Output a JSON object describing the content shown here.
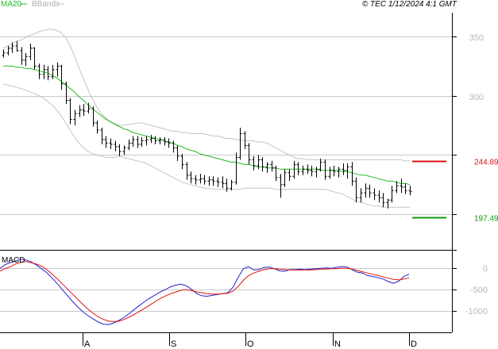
{
  "header": {
    "ma_label": "MA20",
    "bb_label": "BBands",
    "copyright": "© TEC 1/12/2024 4:1 GMT"
  },
  "colors": {
    "ma": "#22bb22",
    "bands": "#c4c4c4",
    "price": "#000000",
    "resistance": "#dd1111",
    "support": "#119911",
    "macd": "#2222cc",
    "signal": "#dd1111",
    "grid": "#c8c8c8",
    "tick": "#b8b8b8"
  },
  "chart_data": [
    {
      "type": "candlestick",
      "name": "price",
      "ylim": [
        170,
        370
      ],
      "yticks": [
        200,
        250,
        300,
        350
      ],
      "ytick_labels": [
        "",
        "",
        "300",
        "350"
      ],
      "x_months": [
        "A",
        "S",
        "O",
        "N",
        "D"
      ],
      "levels": [
        {
          "label": "244.89",
          "value": 244.89,
          "color": "#dd1111"
        },
        {
          "label": "197.49",
          "value": 197.49,
          "color": "#119911"
        }
      ],
      "bars": [
        [
          334,
          339,
          332,
          336
        ],
        [
          336,
          342,
          334,
          340
        ],
        [
          340,
          345,
          336,
          342
        ],
        [
          342,
          346,
          337,
          338
        ],
        [
          338,
          341,
          326,
          330
        ],
        [
          330,
          336,
          325,
          333
        ],
        [
          333,
          344,
          330,
          340
        ],
        [
          340,
          341,
          322,
          325
        ],
        [
          325,
          327,
          314,
          318
        ],
        [
          318,
          326,
          314,
          322
        ],
        [
          322,
          325,
          313,
          316
        ],
        [
          316,
          326,
          314,
          322
        ],
        [
          322,
          328,
          316,
          325
        ],
        [
          325,
          326,
          305,
          310
        ],
        [
          310,
          312,
          293,
          296
        ],
        [
          296,
          298,
          276,
          280
        ],
        [
          280,
          288,
          275,
          285
        ],
        [
          285,
          292,
          282,
          288
        ],
        [
          288,
          293,
          283,
          287
        ],
        [
          287,
          294,
          285,
          289
        ],
        [
          289,
          291,
          274,
          277
        ],
        [
          277,
          279,
          268,
          271
        ],
        [
          271,
          273,
          259,
          263
        ],
        [
          263,
          266,
          256,
          260
        ],
        [
          260,
          264,
          255,
          259
        ],
        [
          259,
          262,
          253,
          257
        ],
        [
          257,
          259,
          249,
          253
        ],
        [
          253,
          258,
          250,
          256
        ],
        [
          256,
          263,
          254,
          260
        ],
        [
          260,
          266,
          257,
          263
        ],
        [
          263,
          266,
          256,
          259
        ],
        [
          259,
          265,
          257,
          262
        ],
        [
          262,
          266,
          258,
          263
        ],
        [
          263,
          267,
          260,
          264
        ],
        [
          264,
          266,
          259,
          262
        ],
        [
          262,
          265,
          259,
          263
        ],
        [
          263,
          265,
          258,
          261
        ],
        [
          261,
          264,
          256,
          260
        ],
        [
          260,
          262,
          252,
          256
        ],
        [
          256,
          258,
          245,
          249
        ],
        [
          249,
          251,
          238,
          242
        ],
        [
          242,
          244,
          229,
          233
        ],
        [
          233,
          236,
          226,
          230
        ],
        [
          230,
          233,
          225,
          229
        ],
        [
          229,
          234,
          226,
          230
        ],
        [
          230,
          233,
          225,
          228
        ],
        [
          228,
          232,
          224,
          229
        ],
        [
          229,
          232,
          224,
          228
        ],
        [
          228,
          231,
          223,
          227
        ],
        [
          227,
          232,
          222,
          226
        ],
        [
          226,
          230,
          219,
          222
        ],
        [
          222,
          229,
          220,
          227
        ],
        [
          227,
          252,
          225,
          248
        ],
        [
          248,
          273,
          246,
          268
        ],
        [
          268,
          270,
          255,
          258
        ],
        [
          258,
          260,
          242,
          246
        ],
        [
          246,
          249,
          237,
          241
        ],
        [
          241,
          250,
          238,
          246
        ],
        [
          246,
          248,
          236,
          240
        ],
        [
          240,
          244,
          235,
          242
        ],
        [
          242,
          245,
          236,
          239
        ],
        [
          239,
          241,
          228,
          231
        ],
        [
          231,
          234,
          214,
          225
        ],
        [
          225,
          238,
          223,
          235
        ],
        [
          235,
          238,
          228,
          232
        ],
        [
          232,
          245,
          230,
          242
        ],
        [
          242,
          244,
          233,
          236
        ],
        [
          236,
          241,
          233,
          238
        ],
        [
          238,
          242,
          234,
          237
        ],
        [
          237,
          241,
          232,
          236
        ],
        [
          236,
          240,
          231,
          238
        ],
        [
          238,
          247,
          236,
          244
        ],
        [
          244,
          246,
          229,
          232
        ],
        [
          232,
          240,
          230,
          237
        ],
        [
          237,
          241,
          232,
          236
        ],
        [
          236,
          240,
          231,
          238
        ],
        [
          238,
          243,
          233,
          237
        ],
        [
          237,
          243,
          230,
          240
        ],
        [
          240,
          244,
          224,
          228
        ],
        [
          228,
          231,
          210,
          214
        ],
        [
          214,
          222,
          210,
          218
        ],
        [
          218,
          226,
          214,
          222
        ],
        [
          222,
          225,
          214,
          218
        ],
        [
          218,
          222,
          212,
          216
        ],
        [
          216,
          220,
          210,
          214
        ],
        [
          214,
          218,
          206,
          210
        ],
        [
          210,
          213,
          205,
          212
        ],
        [
          212,
          224,
          210,
          220
        ],
        [
          220,
          228,
          218,
          224
        ],
        [
          224,
          230,
          218,
          223
        ],
        [
          223,
          226,
          217,
          220
        ],
        [
          220,
          224,
          216,
          219
        ]
      ],
      "ma": [
        325,
        325,
        325,
        324,
        324,
        323,
        323,
        322,
        321,
        320,
        319,
        317,
        315,
        312,
        309,
        306,
        303,
        299,
        296,
        292,
        289,
        286,
        283,
        280,
        278,
        276,
        274,
        272,
        271,
        269,
        268,
        267,
        266,
        265,
        264,
        263,
        262,
        261,
        260,
        258,
        257,
        255,
        254,
        253,
        251,
        250,
        249,
        248,
        247,
        246,
        245,
        244,
        244,
        243,
        242,
        242,
        241,
        240,
        240,
        239,
        239,
        239,
        238,
        238,
        238,
        238,
        238,
        238,
        238,
        238,
        238,
        237,
        237,
        237,
        237,
        237,
        236,
        236,
        235,
        234,
        233,
        233,
        232,
        231,
        230,
        229,
        228,
        228,
        227,
        226,
        226,
        225
      ],
      "bb_upper": [
        340,
        342,
        344,
        346,
        347,
        349,
        351,
        352,
        354,
        355,
        356,
        356,
        355,
        353,
        349,
        342,
        333,
        323,
        314,
        305,
        297,
        290,
        285,
        281,
        278,
        276,
        275,
        275,
        276,
        276,
        277,
        277,
        276,
        275,
        274,
        273,
        272,
        271,
        270,
        270,
        269,
        269,
        268,
        268,
        268,
        268,
        267,
        266,
        266,
        265,
        264,
        264,
        263,
        263,
        262,
        262,
        262,
        261,
        261,
        260,
        258,
        256,
        254,
        252,
        250,
        248,
        247,
        247,
        246,
        246,
        246,
        246,
        246,
        246,
        246,
        246,
        246,
        246,
        246,
        246,
        246,
        246,
        246,
        246,
        246,
        246,
        246,
        246,
        246,
        246,
        245,
        245
      ],
      "bb_lower": [
        310,
        309,
        308,
        307,
        306,
        305,
        303,
        302,
        300,
        298,
        295,
        292,
        288,
        283,
        277,
        271,
        265,
        260,
        256,
        253,
        251,
        250,
        249,
        248,
        248,
        248,
        249,
        248,
        247,
        246,
        245,
        244,
        243,
        241,
        239,
        237,
        235,
        233,
        231,
        229,
        227,
        226,
        225,
        224,
        223,
        222,
        222,
        221,
        221,
        221,
        221,
        221,
        221,
        221,
        222,
        222,
        222,
        222,
        222,
        222,
        222,
        221,
        221,
        221,
        221,
        221,
        221,
        221,
        221,
        221,
        221,
        221,
        221,
        220,
        219,
        218,
        217,
        215,
        213,
        211,
        210,
        209,
        208,
        207,
        207,
        206,
        206,
        206,
        206,
        206,
        206,
        206
      ]
    },
    {
      "type": "line",
      "name": "MACD",
      "title": "MACD",
      "ylim": [
        -1500,
        400
      ],
      "yticks": [
        0,
        -500,
        -1000
      ],
      "ytick_labels": [
        "0",
        "-500",
        "-1000"
      ],
      "series": [
        {
          "name": "macd",
          "values": [
            -15,
            75,
            120,
            160,
            200,
            185,
            140,
            70,
            -20,
            -110,
            -230,
            -360,
            -500,
            -640,
            -780,
            -910,
            -1020,
            -1110,
            -1190,
            -1260,
            -1310,
            -1320,
            -1280,
            -1220,
            -1150,
            -1060,
            -960,
            -870,
            -780,
            -700,
            -630,
            -560,
            -500,
            -440,
            -400,
            -380,
            -420,
            -500,
            -600,
            -650,
            -660,
            -640,
            -620,
            -600,
            -580,
            -450,
            -220,
            -20,
            30,
            -50,
            -40,
            10,
            20,
            -20,
            -70,
            -80,
            -40,
            -40,
            -30,
            -40,
            -30,
            -20,
            -10,
            0,
            -10,
            10,
            30,
            20,
            -40,
            -100,
            -120,
            -180,
            -200,
            -230,
            -260,
            -320,
            -360,
            -310,
            -200,
            -150
          ]
        },
        {
          "name": "signal",
          "values": [
            -70,
            -20,
            30,
            90,
            130,
            150,
            120,
            90,
            40,
            -40,
            -140,
            -250,
            -370,
            -490,
            -610,
            -730,
            -850,
            -960,
            -1060,
            -1140,
            -1200,
            -1240,
            -1250,
            -1240,
            -1200,
            -1140,
            -1080,
            -1010,
            -940,
            -860,
            -780,
            -710,
            -650,
            -600,
            -560,
            -520,
            -510,
            -530,
            -560,
            -580,
            -600,
            -610,
            -610,
            -600,
            -590,
            -540,
            -430,
            -290,
            -180,
            -120,
            -80,
            -40,
            -20,
            -20,
            -30,
            -40,
            -50,
            -50,
            -50,
            -50,
            -50,
            -40,
            -30,
            -30,
            -20,
            -20,
            -10,
            -10,
            -30,
            -60,
            -90,
            -120,
            -150,
            -180,
            -210,
            -240,
            -270,
            -280,
            -260,
            -230
          ]
        }
      ]
    }
  ]
}
